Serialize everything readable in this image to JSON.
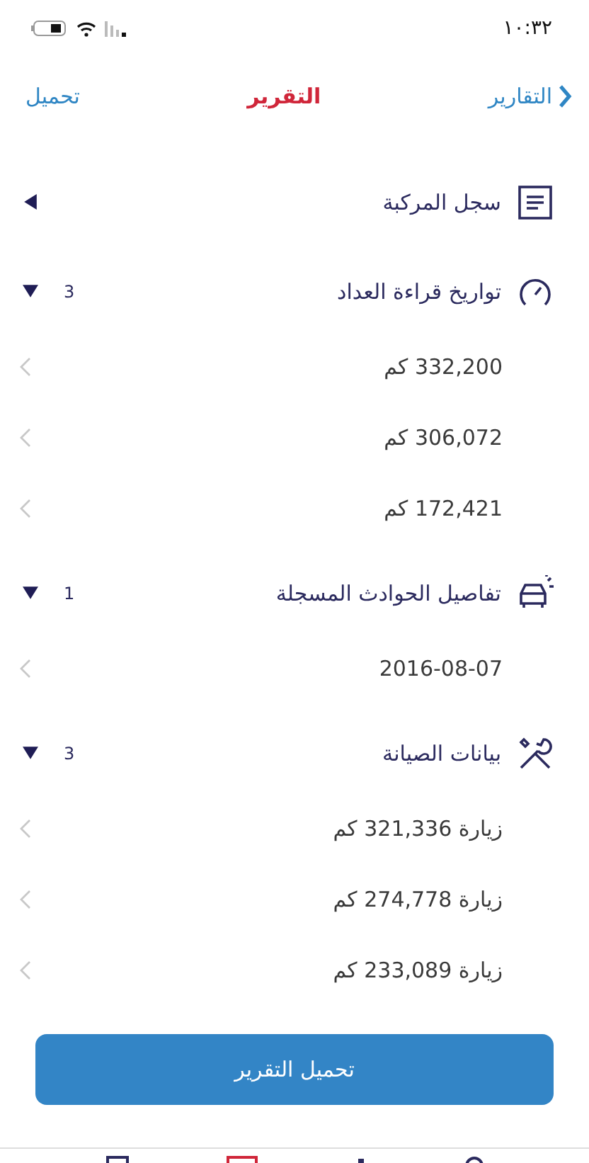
{
  "status_bar": {
    "time": "١٠:٣٢"
  },
  "nav": {
    "back": "التقارير",
    "title": "التقرير",
    "action": "تحميل"
  },
  "sections": [
    {
      "kind": "document",
      "title": "سجل المركبة",
      "expanded": false
    },
    {
      "kind": "gauge",
      "title": "تواريخ قراءة العداد",
      "count": "3",
      "expanded": true,
      "items": [
        "332,200 كم",
        "306,072 كم",
        "172,421 كم"
      ]
    },
    {
      "kind": "car",
      "title": "تفاصيل الحوادث المسجلة",
      "count": "1",
      "expanded": true,
      "items": [
        "2016-08-07"
      ]
    },
    {
      "kind": "tools",
      "title": "بيانات الصيانة",
      "count": "3",
      "expanded": true,
      "items": [
        "زيارة 321,336 كم",
        "زيارة 274,778 كم",
        "زيارة 233,089 كم"
      ]
    }
  ],
  "download_button": "تحميل التقرير"
}
